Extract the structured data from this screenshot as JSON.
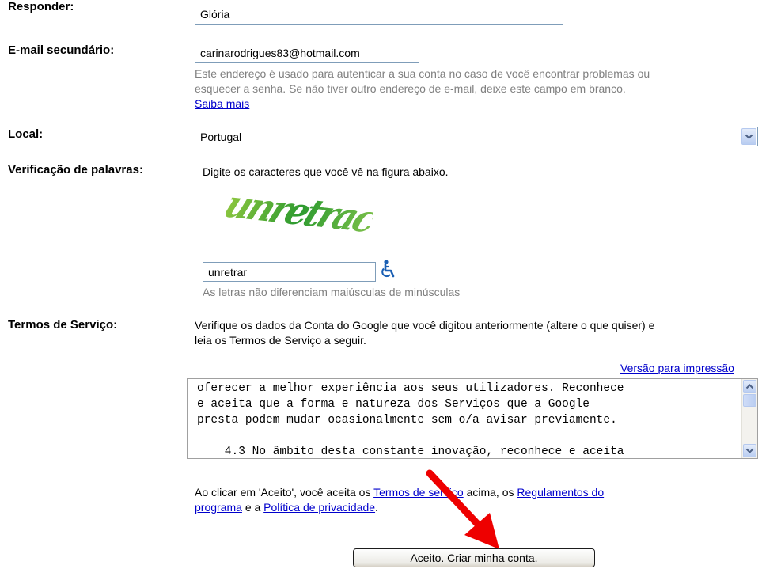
{
  "fields": {
    "responder": {
      "label": "Responder:",
      "value": "Glória"
    },
    "secondary_email": {
      "label": "E-mail secundário:",
      "value": "carinarodrigues83@hotmail.com",
      "help_line1": "Este endereço é usado para autenticar a sua conta no caso de você encontrar problemas ou",
      "help_line2": "esquecer a senha. Se não tiver outro endereço de e-mail, deixe este campo em branco.",
      "learn_more": "Saiba mais"
    },
    "location": {
      "label": "Local:",
      "selected": "Portugal"
    },
    "word_verification": {
      "label": "Verificação de palavras:",
      "instruction": "Digite os caracteres que você vê na figura abaixo.",
      "captcha_text": "unretrac",
      "value": "unretrar",
      "help": "As letras não diferenciam maiúsculas de minúsculas"
    }
  },
  "terms": {
    "label": "Termos de Serviço:",
    "intro_line1": "Verifique os dados da Conta do Google que você digitou anteriormente (altere o que quiser) e",
    "intro_line2": "leia os Termos de Serviço a seguir.",
    "print_link": "Versão para impressão",
    "content": [
      "oferecer a melhor experiência aos seus utilizadores. Reconhece",
      "e aceita que a forma e natureza dos Serviços que a Google",
      "presta podem mudar ocasionalmente sem o/a avisar previamente.",
      "",
      "    4.3 No âmbito desta constante inovação, reconhece e aceita"
    ],
    "accept_text_1": "Ao clicar em 'Aceito', você aceita os",
    "accept_link_tos": "Termos de serviço",
    "accept_text_2": "acima, os",
    "accept_link_program": "Regulamentos do",
    "accept_link_program_2": "programa",
    "accept_text_3": "e a",
    "accept_link_privacy": "Política de privacidade",
    "accept_text_4": "."
  },
  "submit_label": "Aceito. Criar minha conta.",
  "colors": {
    "link": "#0000cc",
    "help": "#808080",
    "arrow": "#ee0000",
    "captcha": "#3a9b2a"
  }
}
